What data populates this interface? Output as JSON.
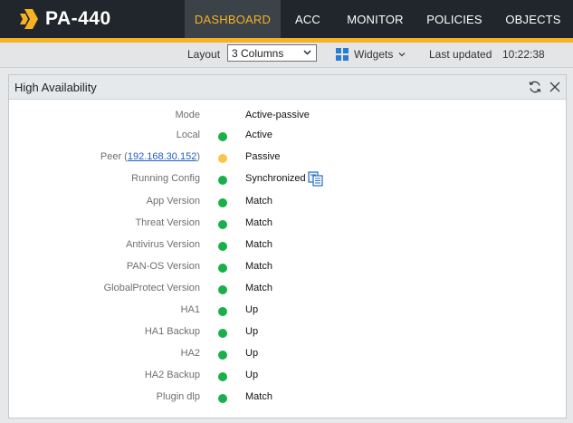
{
  "app": {
    "title": "PA-440",
    "nav": [
      "DASHBOARD",
      "ACC",
      "MONITOR",
      "POLICIES",
      "OBJECTS"
    ],
    "active_nav": "DASHBOARD"
  },
  "toolbar": {
    "layout_label": "Layout",
    "layout_value": "3 Columns",
    "widgets_label": "Widgets",
    "last_updated_label": "Last updated",
    "last_updated_time": "10:22:38"
  },
  "panel": {
    "title": "High Availability",
    "rows": [
      {
        "label": "Mode",
        "value": "Active-passive",
        "status": "none"
      },
      {
        "label": "Local",
        "value": "Active",
        "status": "green"
      },
      {
        "label_prefix": "Peer (",
        "label_link": "192.168.30.152",
        "label_suffix": ")",
        "value": "Passive",
        "status": "yellow"
      },
      {
        "label": "Running Config",
        "value": "Synchronized",
        "status": "green",
        "icon": "sync-config-icon"
      },
      {
        "label": "App Version",
        "value": "Match",
        "status": "green"
      },
      {
        "label": "Threat Version",
        "value": "Match",
        "status": "green"
      },
      {
        "label": "Antivirus Version",
        "value": "Match",
        "status": "green"
      },
      {
        "label": "PAN-OS Version",
        "value": "Match",
        "status": "green"
      },
      {
        "label": "GlobalProtect Version",
        "value": "Match",
        "status": "green"
      },
      {
        "label": "HA1",
        "value": "Up",
        "status": "green"
      },
      {
        "label": "HA1 Backup",
        "value": "Up",
        "status": "green"
      },
      {
        "label": "HA2",
        "value": "Up",
        "status": "green"
      },
      {
        "label": "HA2 Backup",
        "value": "Up",
        "status": "green"
      },
      {
        "label": "Plugin dlp",
        "value": "Match",
        "status": "green"
      }
    ]
  },
  "colors": {
    "accent": "#f5b324",
    "topbar": "#20262b",
    "status_green": "#1aaf4b",
    "status_yellow": "#fcc44a",
    "link": "#1f5fbf"
  }
}
